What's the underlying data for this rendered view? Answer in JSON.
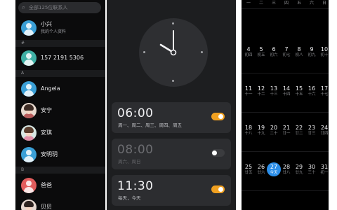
{
  "contacts": {
    "search_placeholder": "全部125位联系人",
    "sections": [
      "#",
      "A",
      "B"
    ],
    "me": {
      "name": "小兴",
      "subtitle": "我的个人资料"
    },
    "items": [
      {
        "name": "157 2191 5306",
        "color": "#3fb0a5",
        "kind": "icon"
      },
      {
        "name": "Angela",
        "color": "#3a9fd6",
        "kind": "icon"
      },
      {
        "name": "安宁",
        "color": "#e7d9cf",
        "kind": "photo"
      },
      {
        "name": "安琪",
        "color": "#d8e8e5",
        "kind": "photo"
      },
      {
        "name": "安明玥",
        "color": "#3a9fd6",
        "kind": "icon"
      },
      {
        "name": "爸爸",
        "color": "#e25d5d",
        "kind": "icon"
      },
      {
        "name": "贝贝",
        "color": "#e6d8d0",
        "kind": "photo"
      }
    ]
  },
  "clock": {
    "alarms": [
      {
        "time": "06:00",
        "days": "周一、周二、周三、周四、周五",
        "enabled": true
      },
      {
        "time": "08:00",
        "days": "周六、周日",
        "enabled": false
      },
      {
        "time": "11:30",
        "days": "每天，今天",
        "enabled": true
      }
    ],
    "accent": "#f0a020"
  },
  "calendar": {
    "weekdays": [
      "一",
      "二",
      "三",
      "四",
      "五",
      "六",
      "日"
    ],
    "weeks": [
      [
        {
          "d": "",
          "l": ""
        },
        {
          "d": "",
          "l": ""
        },
        {
          "d": "",
          "l": ""
        },
        {
          "d": "",
          "l": ""
        },
        {
          "d": "",
          "l": ""
        },
        {
          "d": "",
          "l": ""
        },
        {
          "d": "",
          "l": ""
        }
      ],
      [
        {
          "d": "4",
          "l": "初四"
        },
        {
          "d": "5",
          "l": "初五"
        },
        {
          "d": "6",
          "l": "初六"
        },
        {
          "d": "7",
          "l": "初七"
        },
        {
          "d": "8",
          "l": "初八"
        },
        {
          "d": "9",
          "l": "初九"
        },
        {
          "d": "10",
          "l": "初十"
        }
      ],
      [
        {
          "d": "11",
          "l": "十一"
        },
        {
          "d": "12",
          "l": "十二"
        },
        {
          "d": "13",
          "l": "十三"
        },
        {
          "d": "14",
          "l": "十四"
        },
        {
          "d": "15",
          "l": "十五"
        },
        {
          "d": "16",
          "l": "十六"
        },
        {
          "d": "17",
          "l": "十七"
        }
      ],
      [
        {
          "d": "18",
          "l": "十八"
        },
        {
          "d": "19",
          "l": "十九"
        },
        {
          "d": "20",
          "l": "二十"
        },
        {
          "d": "21",
          "l": "廿一"
        },
        {
          "d": "22",
          "l": "廿二"
        },
        {
          "d": "23",
          "l": "廿三"
        },
        {
          "d": "24",
          "l": "廿四"
        }
      ],
      [
        {
          "d": "25",
          "l": "廿五"
        },
        {
          "d": "26",
          "l": "廿六"
        },
        {
          "d": "27",
          "l": "今天"
        },
        {
          "d": "28",
          "l": "廿八"
        },
        {
          "d": "29",
          "l": "廿九"
        },
        {
          "d": "30",
          "l": "三十"
        },
        {
          "d": "31",
          "l": "初一"
        }
      ]
    ],
    "selected_day": "27",
    "accent": "#2b8ee8"
  }
}
